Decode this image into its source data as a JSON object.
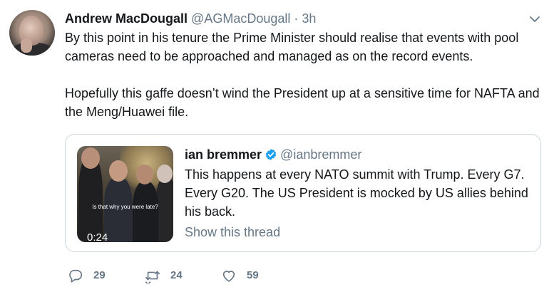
{
  "tweet": {
    "author_name": "Andrew MacDougall",
    "author_handle": "@AGMacDougall",
    "separator": "·",
    "time": "3h",
    "paragraphs": [
      "By this point in his tenure the Prime Minister should realise that events with pool cameras need to be approached and managed as on the record events.",
      "Hopefully this gaffe doesn’t wind the President up at a sensitive time for NAFTA and the Meng/Huawei file."
    ]
  },
  "quoted": {
    "author_name": "ian bremmer",
    "author_handle": "@ianbremmer",
    "verified": true,
    "text": "This happens at every NATO summit with Trump. Every G7. Every G20. The US President is mocked by US allies behind his back.",
    "video_caption": "Is that why you were late?",
    "video_duration": "0:24",
    "show_thread": "Show this thread"
  },
  "actions": {
    "replies": "29",
    "retweets": "24",
    "likes": "59"
  },
  "colors": {
    "text": "#14171a",
    "secondary": "#657786",
    "border": "#ccd6dd",
    "verified": "#1da1f2"
  },
  "icons": [
    "chevron-down-icon",
    "verified-icon",
    "reply-icon",
    "retweet-icon",
    "like-icon"
  ]
}
